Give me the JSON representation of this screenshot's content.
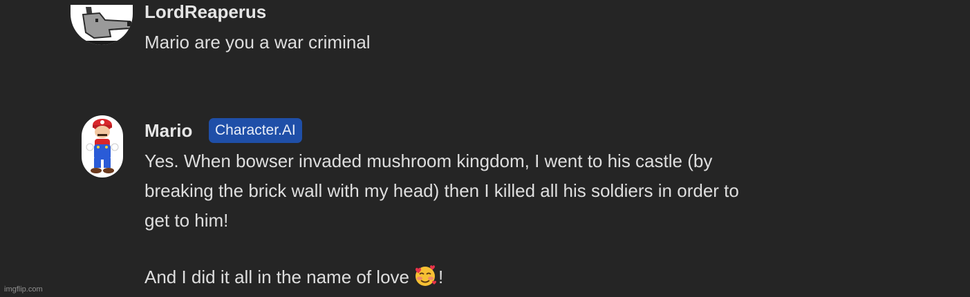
{
  "messages": [
    {
      "author": "LordReaperus",
      "avatar_icon": "wolf-avatar-icon",
      "text": "Mario are you a war criminal"
    },
    {
      "author": "Mario",
      "badge": "Character.AI",
      "avatar_icon": "mario-avatar-icon",
      "lines": [
        "Yes. When bowser invaded mushroom kingdom, I went to his castle (by",
        "breaking the brick wall with my head) then I killed all his soldiers in order to",
        "get to him!"
      ],
      "closing_text": "And I did it all in the name of love",
      "closing_emoji": "smiling-face-with-hearts-icon",
      "closing_punct": "!"
    }
  ],
  "watermark": "imgflip.com",
  "colors": {
    "background": "#252525",
    "badge": "#1f4fa8"
  }
}
